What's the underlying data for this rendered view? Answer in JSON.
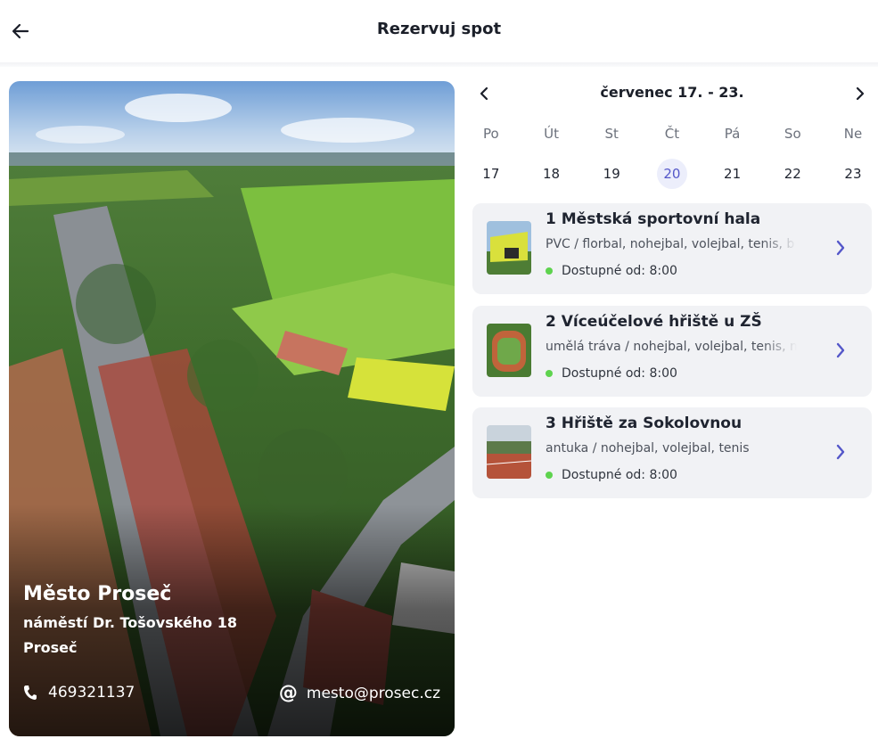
{
  "header": {
    "title": "Rezervuj spot"
  },
  "hero": {
    "name": "Město Proseč",
    "street": "náměstí Dr. Tošovského 18",
    "city": "Proseč",
    "phone": "469321137",
    "email": "mesto@prosec.cz"
  },
  "calendar": {
    "title": "červenec 17. - 23.",
    "weekdays": [
      "Po",
      "Út",
      "St",
      "Čt",
      "Pá",
      "So",
      "Ne"
    ],
    "days": [
      "17",
      "18",
      "19",
      "20",
      "21",
      "22",
      "23"
    ],
    "selected_day": "20"
  },
  "venues": [
    {
      "name": "1 Městská sportovní hala",
      "surfaces": "PVC / florbal, nohejbal, volejbal, tenis, b",
      "availability": "Dostupné od: 8:00"
    },
    {
      "name": "2 Víceúčelové hřiště u ZŠ",
      "surfaces": "umělá tráva / nohejbal, volejbal, tenis, m",
      "availability": "Dostupné od: 8:00"
    },
    {
      "name": "3 Hřiště za Sokolovnou",
      "surfaces": "antuka / nohejbal, volejbal, tenis",
      "availability": "Dostupné od: 8:00"
    }
  ],
  "colors": {
    "accent": "#5457c9",
    "available_dot": "#5ed34e",
    "card_bg": "#f1f2f5"
  },
  "icons": {
    "back": "arrow-left-icon",
    "prev": "chevron-left-icon",
    "next": "chevron-right-icon",
    "phone": "phone-icon",
    "email": "at-icon",
    "venue_open": "chevron-right-icon"
  }
}
